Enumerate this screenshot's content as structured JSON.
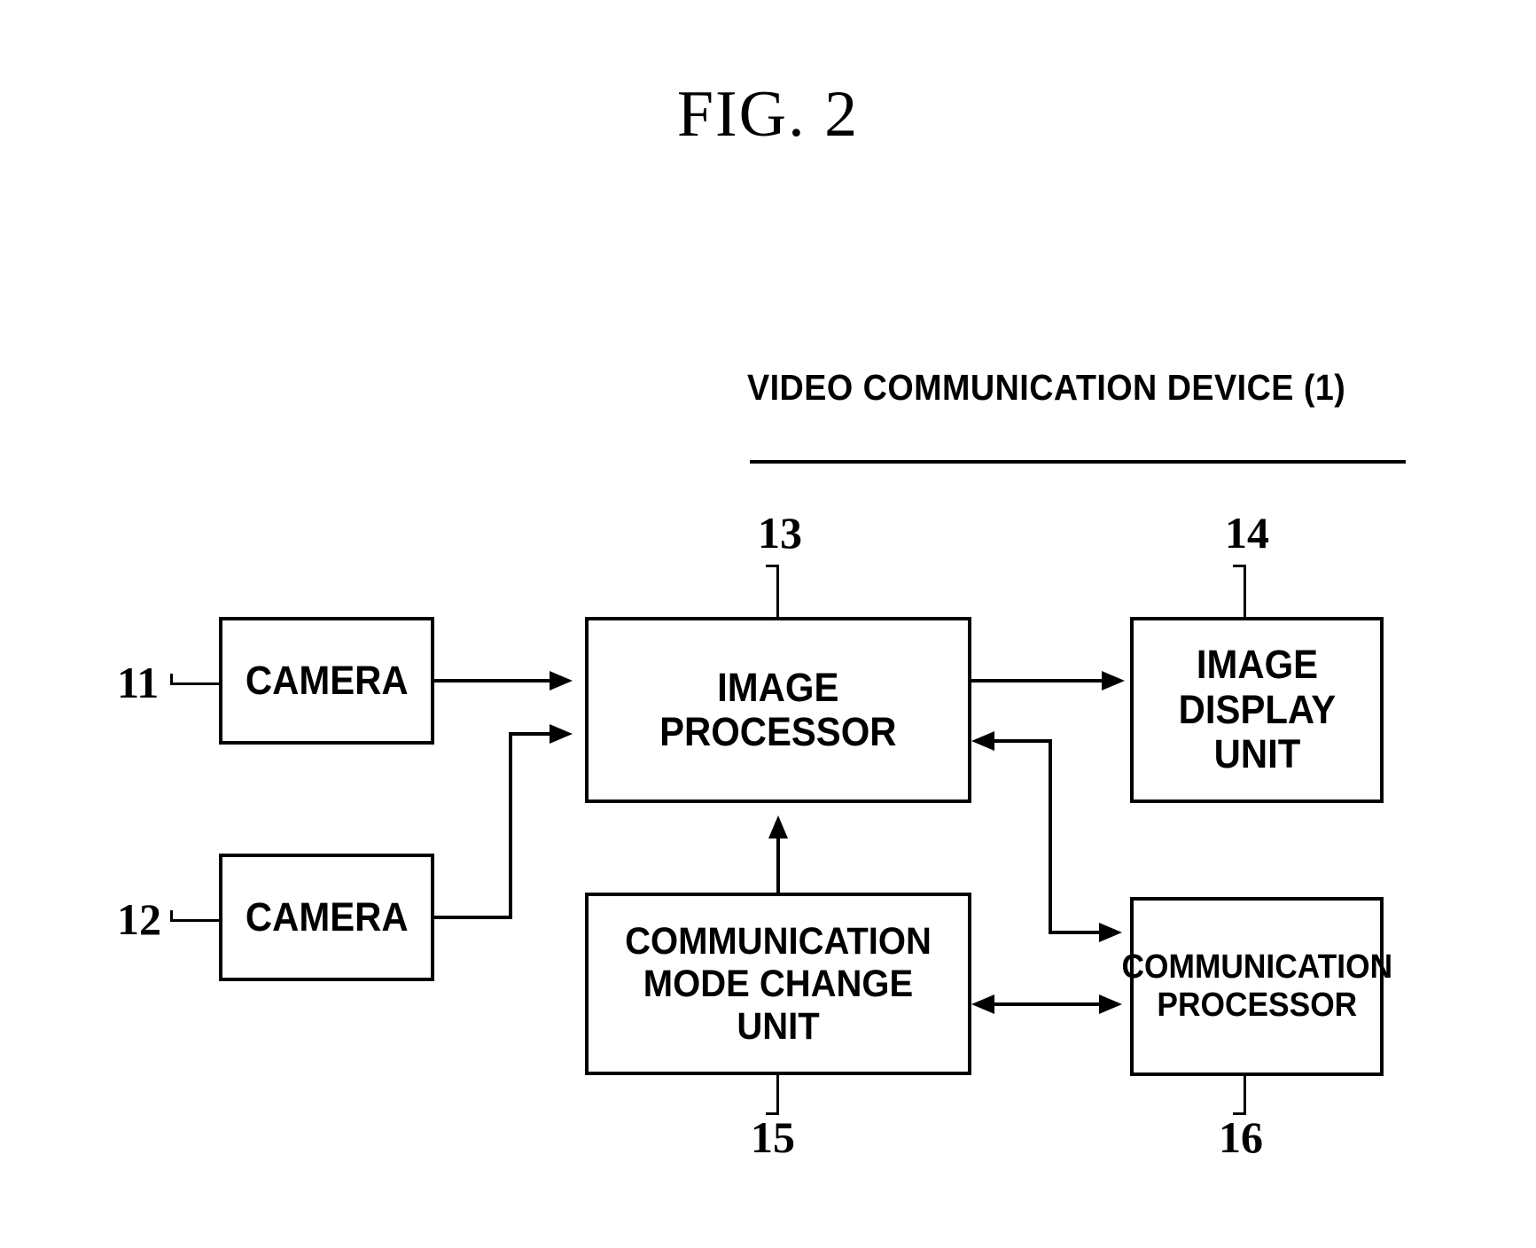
{
  "figure": {
    "title": "FIG. 2",
    "header": "VIDEO COMMUNICATION DEVICE (1)"
  },
  "blocks": [
    {
      "id": "camera-1",
      "label_lines": [
        "CAMERA"
      ],
      "ref": "11"
    },
    {
      "id": "camera-2",
      "label_lines": [
        "CAMERA"
      ],
      "ref": "12"
    },
    {
      "id": "image-processor",
      "label_lines": [
        "IMAGE",
        "PROCESSOR"
      ],
      "ref": "13"
    },
    {
      "id": "image-display",
      "label_lines": [
        "IMAGE",
        "DISPLAY",
        "UNIT"
      ],
      "ref": "14"
    },
    {
      "id": "mode-change",
      "label_lines": [
        "COMMUNICATION",
        "MODE CHANGE UNIT"
      ],
      "ref": "15"
    },
    {
      "id": "comm-processor",
      "label_lines": [
        "COMMUNICATION",
        "PROCESSOR"
      ],
      "ref": "16"
    }
  ],
  "labels": {
    "camera_1": "CAMERA",
    "camera_2": "CAMERA",
    "image_processor_l1": "IMAGE",
    "image_processor_l2": "PROCESSOR",
    "image_display_l1": "IMAGE",
    "image_display_l2": "DISPLAY",
    "image_display_l3": "UNIT",
    "mode_change_l1": "COMMUNICATION",
    "mode_change_l2": "MODE CHANGE UNIT",
    "comm_processor_l1": "COMMUNICATION",
    "comm_processor_l2": "PROCESSOR"
  },
  "refs": {
    "r11": "11",
    "r12": "12",
    "r13": "13",
    "r14": "14",
    "r15": "15",
    "r16": "16"
  },
  "connections": [
    {
      "from": "camera-1",
      "to": "image-processor",
      "direction": "one-way"
    },
    {
      "from": "camera-2",
      "to": "image-processor",
      "direction": "one-way"
    },
    {
      "from": "image-processor",
      "to": "image-display",
      "direction": "one-way"
    },
    {
      "from": "comm-processor",
      "to": "image-processor",
      "direction": "one-way"
    },
    {
      "from": "comm-processor",
      "to": "mode-change",
      "direction": "two-way"
    },
    {
      "from": "mode-change",
      "to": "image-processor",
      "direction": "one-way"
    }
  ],
  "colors": {
    "line": "#000000",
    "background": "#ffffff"
  }
}
